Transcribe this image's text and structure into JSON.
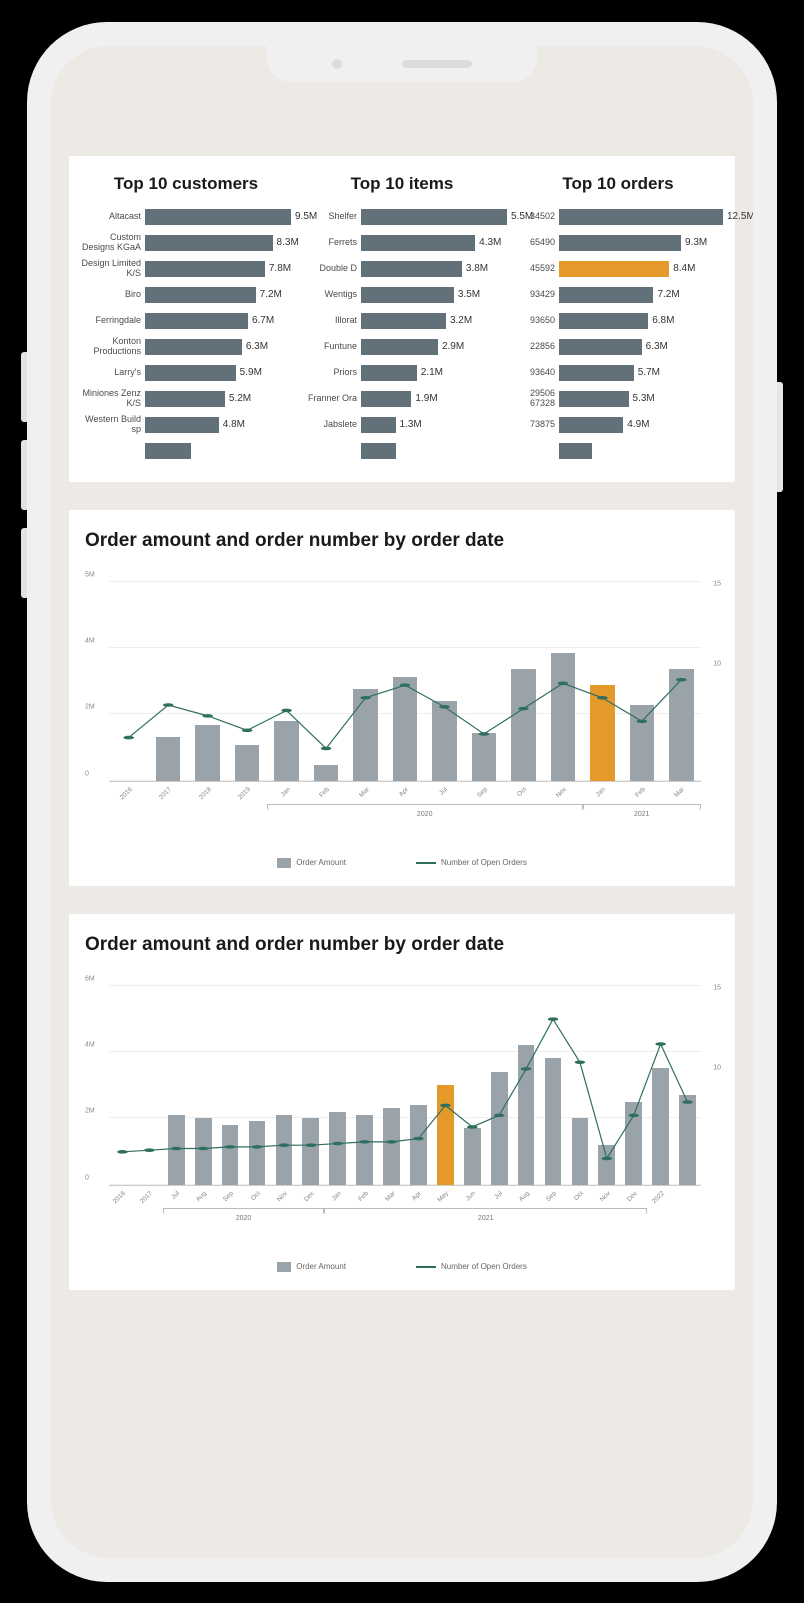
{
  "top10": {
    "customers": {
      "title": "Top 10 customers",
      "max": 9.5,
      "rows": [
        {
          "label": "Altacast",
          "value": 9.5,
          "display": "9.5M"
        },
        {
          "label": "Custom Designs KGaA",
          "value": 8.3,
          "display": "8.3M"
        },
        {
          "label": "Design Limited K/S",
          "value": 7.8,
          "display": "7.8M"
        },
        {
          "label": "Biro",
          "value": 7.2,
          "display": "7.2M"
        },
        {
          "label": "Ferringdale",
          "value": 6.7,
          "display": "6.7M"
        },
        {
          "label": "Konton Productions",
          "value": 6.3,
          "display": "6.3M"
        },
        {
          "label": "Larry's",
          "value": 5.9,
          "display": "5.9M"
        },
        {
          "label": "Miniones Zenz K/S",
          "value": 5.2,
          "display": "5.2M"
        },
        {
          "label": "Western Build sp",
          "value": 4.8,
          "display": "4.8M"
        },
        {
          "label": "",
          "value": 3.0,
          "display": ""
        }
      ]
    },
    "items": {
      "title": "Top 10 items",
      "max": 5.5,
      "rows": [
        {
          "label": "Shelfer",
          "value": 5.5,
          "display": "5.5M"
        },
        {
          "label": "Ferrets",
          "value": 4.3,
          "display": "4.3M"
        },
        {
          "label": "Double D",
          "value": 3.8,
          "display": "3.8M"
        },
        {
          "label": "Wentigs",
          "value": 3.5,
          "display": "3.5M"
        },
        {
          "label": "Illorat",
          "value": 3.2,
          "display": "3.2M"
        },
        {
          "label": "Funtune",
          "value": 2.9,
          "display": "2.9M"
        },
        {
          "label": "Priors",
          "value": 2.1,
          "display": "2.1M"
        },
        {
          "label": "Franner Ora",
          "value": 1.9,
          "display": "1.9M"
        },
        {
          "label": "Jabslete",
          "value": 1.3,
          "display": "1.3M"
        },
        {
          "label": "",
          "value": 1.3,
          "display": ""
        }
      ]
    },
    "orders": {
      "title": "Top 10 orders",
      "max": 12.5,
      "rows": [
        {
          "label": "34502",
          "value": 12.5,
          "display": "12.5M"
        },
        {
          "label": "65490",
          "value": 9.3,
          "display": "9.3M"
        },
        {
          "label": "45592",
          "value": 8.4,
          "display": "8.4M",
          "highlight": true
        },
        {
          "label": "93429",
          "value": 7.2,
          "display": "7.2M"
        },
        {
          "label": "93650",
          "value": 6.8,
          "display": "6.8M"
        },
        {
          "label": "22856",
          "value": 6.3,
          "display": "6.3M"
        },
        {
          "label": "93640",
          "value": 5.7,
          "display": "5.7M"
        },
        {
          "label": "29506 67328",
          "value": 5.3,
          "display": "5.3M"
        },
        {
          "label": "73875",
          "value": 4.9,
          "display": "4.9M"
        },
        {
          "label": "",
          "value": 2.5,
          "display": ""
        }
      ]
    }
  },
  "combo1": {
    "title": "Order amount and order number by order date",
    "y_ticks": [
      "0",
      "2M",
      "4M",
      "5M"
    ],
    "y2_ticks": [
      "10",
      "15"
    ],
    "y_max": 5,
    "y2_range": [
      4,
      15
    ],
    "categories": [
      "2016",
      "2017",
      "2018",
      "2019",
      "Jan",
      "Feb",
      "Mar",
      "Apr",
      "Jul",
      "Sep",
      "Oct",
      "Nov",
      "Jan",
      "Feb",
      "Mar"
    ],
    "groups": [
      {
        "label": "2020",
        "from": 4,
        "to": 11
      },
      {
        "label": "2021",
        "from": 12,
        "to": 14
      }
    ],
    "bars": [
      0.0,
      1.1,
      1.4,
      0.9,
      1.5,
      0.4,
      2.3,
      2.6,
      2.0,
      1.2,
      2.8,
      3.2,
      2.4,
      1.9,
      2.8
    ],
    "highlight_index": 12,
    "line": [
      6.4,
      8.2,
      7.6,
      6.8,
      7.9,
      5.8,
      8.6,
      9.3,
      8.1,
      6.6,
      8.0,
      9.4,
      8.6,
      7.3,
      9.6
    ],
    "legend": {
      "bar": "Order Amount",
      "line": "Number of Open Orders"
    }
  },
  "combo2": {
    "title": "Order amount and order number by order date",
    "y_ticks": [
      "0",
      "2M",
      "4M",
      "6M"
    ],
    "y2_ticks": [
      "10",
      "15"
    ],
    "y_max": 6,
    "y2_range": [
      3,
      15
    ],
    "categories": [
      "2016",
      "2017",
      "Jul",
      "Aug",
      "Sep",
      "Oct",
      "Nov",
      "Dec",
      "Jan",
      "Feb",
      "Mar",
      "Apr",
      "May",
      "Jun",
      "Jul",
      "Aug",
      "Sep",
      "Oct",
      "Nov",
      "Dec",
      "2022",
      ""
    ],
    "groups": [
      {
        "label": "2020",
        "from": 2,
        "to": 7
      },
      {
        "label": "2021",
        "from": 8,
        "to": 19
      }
    ],
    "bars": [
      0,
      0,
      2.1,
      2.0,
      1.8,
      1.9,
      2.1,
      2.0,
      2.2,
      2.1,
      2.3,
      2.4,
      3.0,
      1.7,
      3.4,
      4.2,
      3.8,
      2.0,
      1.2,
      2.5,
      3.5,
      2.7
    ],
    "highlight_index": 12,
    "line": [
      5.0,
      5.1,
      5.2,
      5.2,
      5.3,
      5.3,
      5.4,
      5.4,
      5.5,
      5.6,
      5.6,
      5.8,
      7.8,
      6.5,
      7.2,
      10.0,
      13.0,
      10.4,
      4.6,
      7.2,
      11.5,
      8.0
    ],
    "legend": {
      "bar": "Order Amount",
      "line": "Number of Open Orders"
    }
  },
  "chart_data": [
    {
      "type": "bar",
      "title": "Top 10 customers",
      "orientation": "horizontal",
      "categories": [
        "Altacast",
        "Custom Designs KGaA",
        "Design Limited K/S",
        "Biro",
        "Ferringdale",
        "Konton Productions",
        "Larry's",
        "Miniones Zenz K/S",
        "Western Build sp"
      ],
      "values": [
        9.5,
        8.3,
        7.8,
        7.2,
        6.7,
        6.3,
        5.9,
        5.2,
        4.8
      ],
      "unit": "M"
    },
    {
      "type": "bar",
      "title": "Top 10 items",
      "orientation": "horizontal",
      "categories": [
        "Shelfer",
        "Ferrets",
        "Double D",
        "Wentigs",
        "Illorat",
        "Funtune",
        "Priors",
        "Franner Ora",
        "Jabslete"
      ],
      "values": [
        5.5,
        4.3,
        3.8,
        3.5,
        3.2,
        2.9,
        2.1,
        1.9,
        1.3
      ],
      "unit": "M"
    },
    {
      "type": "bar",
      "title": "Top 10 orders",
      "orientation": "horizontal",
      "categories": [
        "34502",
        "65490",
        "45592",
        "93429",
        "93650",
        "22856",
        "93640",
        "29506 67328",
        "73875"
      ],
      "values": [
        12.5,
        9.3,
        8.4,
        7.2,
        6.8,
        6.3,
        5.7,
        5.3,
        4.9
      ],
      "unit": "M",
      "highlight_category": "45592"
    },
    {
      "type": "bar+line",
      "title": "Order amount and order number by order date",
      "categories": [
        "2016",
        "2017",
        "2018",
        "2019",
        "2020-Jan",
        "2020-Feb",
        "2020-Mar",
        "2020-Apr",
        "2020-Jul",
        "2020-Sep",
        "2020-Oct",
        "2020-Nov",
        "2021-Jan",
        "2021-Feb",
        "2021-Mar"
      ],
      "series": [
        {
          "name": "Order Amount",
          "kind": "bar",
          "values": [
            0.0,
            1.1,
            1.4,
            0.9,
            1.5,
            0.4,
            2.3,
            2.6,
            2.0,
            1.2,
            2.8,
            3.2,
            2.4,
            1.9,
            2.8
          ],
          "unit": "M",
          "highlight_index": 12
        },
        {
          "name": "Number of Open Orders",
          "kind": "line",
          "values": [
            6.4,
            8.2,
            7.6,
            6.8,
            7.9,
            5.8,
            8.6,
            9.3,
            8.1,
            6.6,
            8.0,
            9.4,
            8.6,
            7.3,
            9.6
          ]
        }
      ],
      "ylabel": "",
      "ylim": [
        0,
        5
      ],
      "y2lim": [
        0,
        15
      ]
    },
    {
      "type": "bar+line",
      "title": "Order amount and order number by order date",
      "categories": [
        "2016",
        "2017",
        "2020-Jul",
        "2020-Aug",
        "2020-Sep",
        "2020-Oct",
        "2020-Nov",
        "2020-Dec",
        "2021-Jan",
        "2021-Feb",
        "2021-Mar",
        "2021-Apr",
        "2021-May",
        "2021-Jun",
        "2021-Jul",
        "2021-Aug",
        "2021-Sep",
        "2021-Oct",
        "2021-Nov",
        "2021-Dec",
        "2022",
        ""
      ],
      "series": [
        {
          "name": "Order Amount",
          "kind": "bar",
          "values": [
            0,
            0,
            2.1,
            2.0,
            1.8,
            1.9,
            2.1,
            2.0,
            2.2,
            2.1,
            2.3,
            2.4,
            3.0,
            1.7,
            3.4,
            4.2,
            3.8,
            2.0,
            1.2,
            2.5,
            3.5,
            2.7
          ],
          "unit": "M",
          "highlight_index": 12
        },
        {
          "name": "Number of Open Orders",
          "kind": "line",
          "values": [
            5.0,
            5.1,
            5.2,
            5.2,
            5.3,
            5.3,
            5.4,
            5.4,
            5.5,
            5.6,
            5.6,
            5.8,
            7.8,
            6.5,
            7.2,
            10.0,
            13.0,
            10.4,
            4.6,
            7.2,
            11.5,
            8.0
          ]
        }
      ],
      "ylabel": "",
      "ylim": [
        0,
        6
      ],
      "y2lim": [
        0,
        15
      ]
    }
  ]
}
